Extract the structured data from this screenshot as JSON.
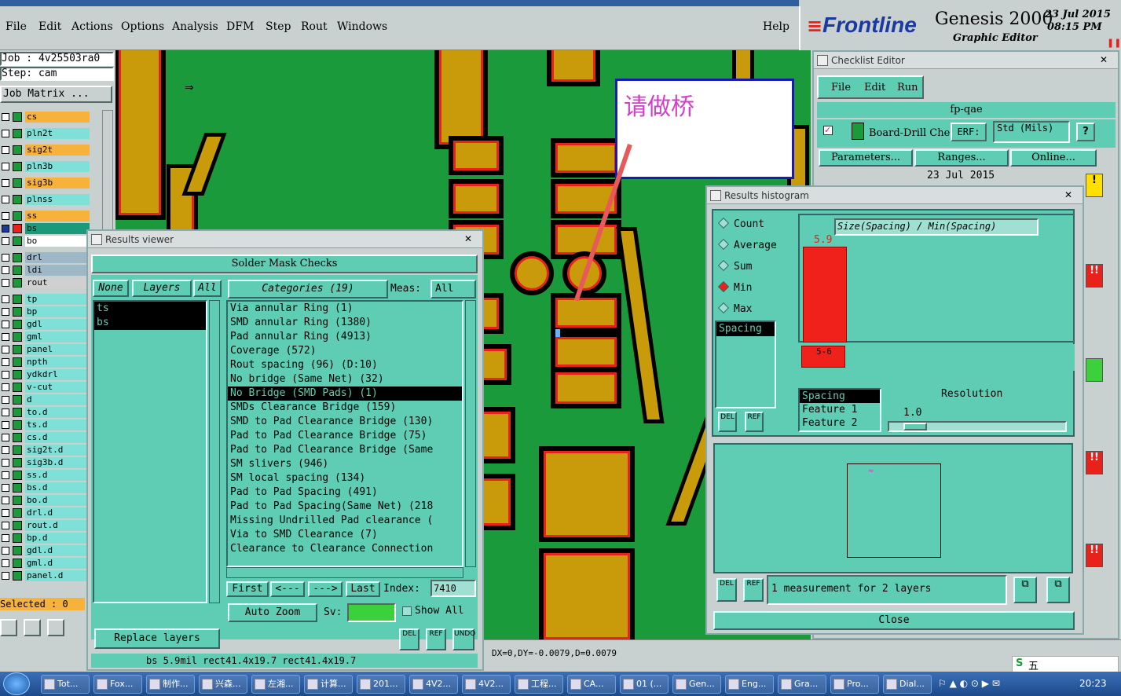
{
  "menu": {
    "items": [
      "File",
      "Edit",
      "Actions",
      "Options",
      "Analysis",
      "DFM",
      "Step",
      "Rout",
      "Windows"
    ],
    "help": "Help"
  },
  "brand": {
    "logo": "Frontline",
    "product": "Genesis 2000",
    "subtitle": "Graphic Editor",
    "date": "23 Jul 2015",
    "time": "08:15 PM"
  },
  "job": {
    "job_line": "Job : 4v25503ra0",
    "step_line": "Step: cam",
    "matrix_button": "Job Matrix ..."
  },
  "layers": [
    {
      "name": "cs",
      "color": "#f7b23c"
    },
    {
      "name": "pln2t",
      "color": "#7fe0d8"
    },
    {
      "name": "sig2t",
      "color": "#f7b23c"
    },
    {
      "name": "pln3b",
      "color": "#7fe0d8"
    },
    {
      "name": "sig3b",
      "color": "#f7b23c"
    },
    {
      "name": "plnss",
      "color": "#7fe0d8"
    },
    {
      "name": "ss",
      "color": "#f7b23c"
    },
    {
      "name": "bs",
      "color": "#1a9a7a"
    },
    {
      "name": "bo",
      "color": "#ffffff"
    },
    {
      "name": "drl",
      "color": "#9fb8c8"
    },
    {
      "name": "ldi",
      "color": "#9fb8c8"
    },
    {
      "name": "rout",
      "color": "#d0d0d0"
    },
    {
      "name": "tp",
      "color": "#7fe0d8"
    },
    {
      "name": "bp",
      "color": "#7fe0d8"
    },
    {
      "name": "gdl",
      "color": "#7fe0d8"
    },
    {
      "name": "gml",
      "color": "#7fe0d8"
    },
    {
      "name": "panel",
      "color": "#7fe0d8"
    },
    {
      "name": "npth",
      "color": "#7fe0d8"
    },
    {
      "name": "ydkdrl",
      "color": "#7fe0d8"
    },
    {
      "name": "v-cut",
      "color": "#7fe0d8"
    },
    {
      "name": "d",
      "color": "#7fe0d8"
    },
    {
      "name": "to.d",
      "color": "#7fe0d8"
    },
    {
      "name": "ts.d",
      "color": "#7fe0d8"
    },
    {
      "name": "cs.d",
      "color": "#7fe0d8"
    },
    {
      "name": "sig2t.d",
      "color": "#7fe0d8"
    },
    {
      "name": "sig3b.d",
      "color": "#7fe0d8"
    },
    {
      "name": "ss.d",
      "color": "#7fe0d8"
    },
    {
      "name": "bs.d",
      "color": "#7fe0d8"
    },
    {
      "name": "bo.d",
      "color": "#7fe0d8"
    },
    {
      "name": "drl.d",
      "color": "#7fe0d8"
    },
    {
      "name": "rout.d",
      "color": "#7fe0d8"
    },
    {
      "name": "bp.d",
      "color": "#7fe0d8"
    },
    {
      "name": "gdl.d",
      "color": "#7fe0d8"
    },
    {
      "name": "gml.d",
      "color": "#7fe0d8"
    },
    {
      "name": "panel.d",
      "color": "#7fe0d8"
    }
  ],
  "selected_text": "Selected : 0",
  "annotation": "请做桥",
  "results_viewer": {
    "title": "Results viewer",
    "header": "Solder Mask Checks",
    "none": "None",
    "layers": "Layers",
    "all": "All",
    "categories": "Categories (19)",
    "meas": "Meas:",
    "meas_value": "All",
    "layer_list": [
      "ts",
      "bs"
    ],
    "category_list": [
      "Via annular Ring (1)",
      "SMD annular Ring (1380)",
      "Pad annular Ring (4913)",
      "Coverage (572)",
      "Rout spacing (96)        (D:10)",
      "No bridge (Same Net) (32)",
      "No Bridge (SMD Pads) (1)",
      "SMDs Clearance Bridge (159)",
      "SMD to Pad Clearance Bridge (130)",
      "Pad to Pad Clearance Bridge (75)",
      "Pad to Pad Clearance Bridge (Same",
      "SM slivers (946)",
      "SM local spacing (134)",
      "Pad to Pad Spacing (491)",
      "Pad to Pad Spacing(Same Net) (218",
      "Missing Undrilled Pad clearance (",
      "Via to SMD Clearance (7)",
      "Clearance to Clearance Connection"
    ],
    "first": "First",
    "prev": "<---",
    "next": "--->",
    "last": "Last",
    "index_label": "Index:",
    "index_value": "7410",
    "auto_zoom": "Auto Zoom",
    "sv": "Sv:",
    "show_all": "Show All",
    "replace_layers": "Replace layers",
    "del": "DEL",
    "ref": "REF",
    "undo": "UNDO",
    "status": "bs 5.9mil  rect41.4x19.7  rect41.4x19.7"
  },
  "checklist": {
    "title": "Checklist Editor",
    "menu": [
      "File",
      "Edit",
      "Run"
    ],
    "name": "fp-qae",
    "row": "Board-Drill Che",
    "erf": "ERF:",
    "std": "Std (Mils)",
    "buttons": [
      "Parameters...",
      "Ranges...",
      "Online..."
    ],
    "date": "23 Jul 2015"
  },
  "histogram": {
    "title": "Results histogram",
    "modes": [
      "Count",
      "Average",
      "Sum",
      "Min",
      "Max"
    ],
    "selected_mode": "Min",
    "chart_title": "Size(Spacing) / Min(Spacing)",
    "bar_value": "5.9",
    "bucket_label": "5-6",
    "list": [
      "Spacing"
    ],
    "feature_list": [
      "Spacing",
      "Feature 1",
      "Feature 2"
    ],
    "resolution_label": "Resolution",
    "resolution_value": "1.0",
    "measurement": "1 measurement for 2 layers",
    "close": "Close",
    "del": "DEL",
    "ref": "REF"
  },
  "coords": "DX=0,DY=-0.0079,D=0.0079",
  "taskbar": {
    "items": [
      "Tot...",
      "Fox...",
      "制作...",
      "兴森...",
      "左湘...",
      "计算...",
      "201...",
      "4V2...",
      "4V2...",
      "工程...",
      "CA...",
      "01 (...",
      "Gen...",
      "Eng...",
      "Gra...",
      "Pro...",
      "Dial..."
    ],
    "time": "20:23",
    "ime": "五"
  },
  "colors": {
    "board": "#1a9a3a",
    "copper": "#c99a0a",
    "clearance": "#e8221a",
    "panel": "#5fcdb4"
  }
}
